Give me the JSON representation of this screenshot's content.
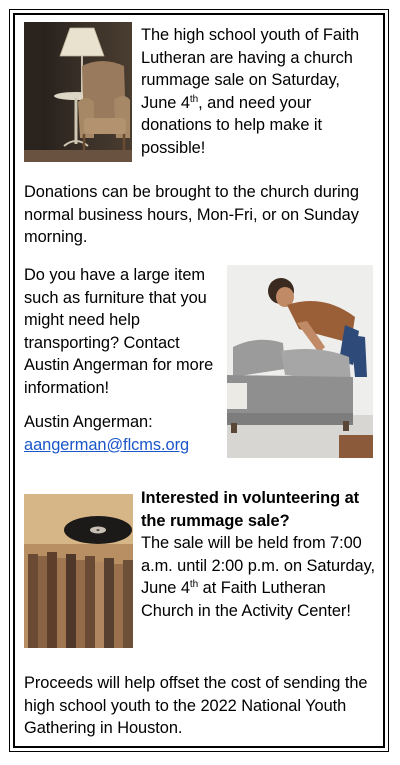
{
  "section1": {
    "text_a": "The high school youth of Faith Lutheran are having a church rummage sale on Saturday, June 4",
    "sup": "th",
    "text_b": ", and need your donations to help make it possible!"
  },
  "section2": {
    "text": "Donations can be brought to the church during normal business hours, Mon-Fri, or on Sunday morning."
  },
  "section3": {
    "text": "Do you have a large item such as furniture that you might need help transporting? Contact Austin Angerman for more information!",
    "contact_label": "Austin Angerman:",
    "email": "aangerman@flcms.org"
  },
  "section4": {
    "heading": "Interested in volunteering at the rummage sale?",
    "text_a": "The sale will be held from 7:00 a.m. until 2:00 p.m. on Saturday, June 4",
    "sup": "th",
    "text_b": " at Faith Lutheran Church in the Activity Center!"
  },
  "section5": {
    "text": "Proceeds will help offset the cost of sending the high school youth to the 2022 National Youth Gathering in Houston."
  },
  "images": {
    "chair": "antique-lamp-and-armchair-photo",
    "sofa": "man-pushing-grey-sofa-photo",
    "records": "vinyl-records-photo"
  }
}
